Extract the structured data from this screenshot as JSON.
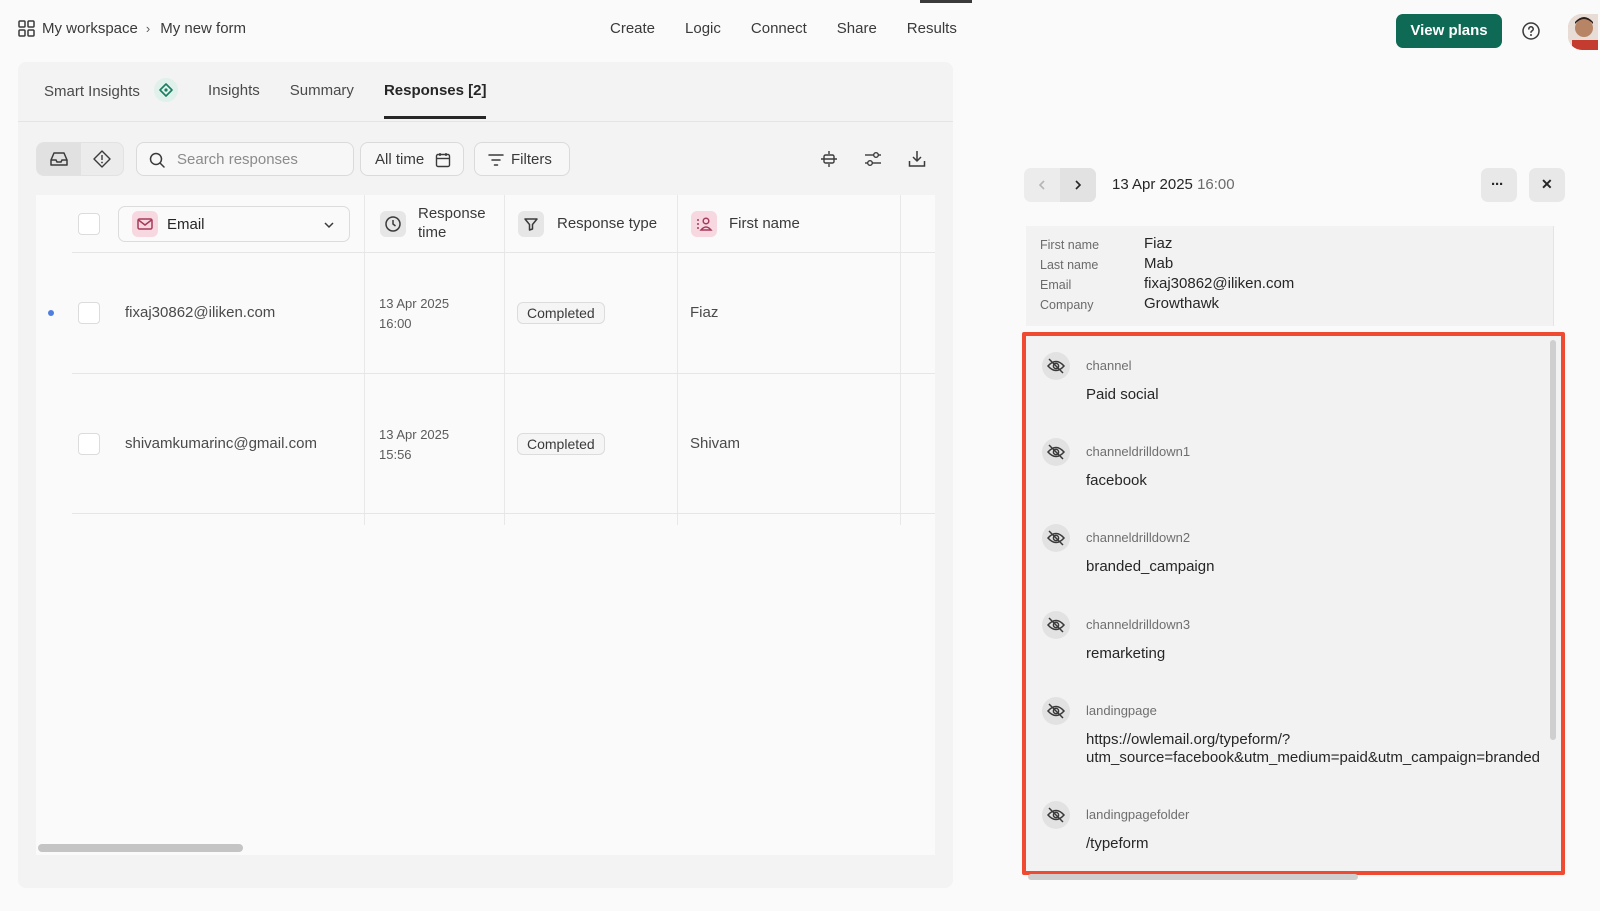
{
  "breadcrumb": {
    "workspace": "My workspace",
    "separator": "›",
    "form": "My new form"
  },
  "main_nav": [
    "Create",
    "Logic",
    "Connect",
    "Share",
    "Results"
  ],
  "active_main_nav": "Results",
  "header_buttons": {
    "view_plans": "View plans"
  },
  "sub_tabs": [
    "Smart Insights",
    "Insights",
    "Summary",
    "Responses [2]"
  ],
  "active_sub_tab": "Responses [2]",
  "toolbar": {
    "search_placeholder": "Search responses",
    "time_filter": "All time",
    "filters": "Filters"
  },
  "table": {
    "columns": {
      "email": "Email",
      "response_time_line1": "Response",
      "response_time_line2": "time",
      "response_type": "Response type",
      "first_name": "First name"
    },
    "rows": [
      {
        "email": "fixaj30862@iliken.com",
        "date": "13 Apr 2025",
        "time": "16:00",
        "type": "Completed",
        "first_name": "Fiaz",
        "unread": true
      },
      {
        "email": "shivamkumarinc@gmail.com",
        "date": "13 Apr 2025",
        "time": "15:56",
        "type": "Completed",
        "first_name": "Shivam",
        "unread": false
      }
    ]
  },
  "detail": {
    "date": "13 Apr 2025",
    "time": "16:00",
    "more_label": "···",
    "close_label": "✕",
    "meta": [
      {
        "key": "First name",
        "value": "Fiaz"
      },
      {
        "key": "Last name",
        "value": "Mab"
      },
      {
        "key": "Email",
        "value": "fixaj30862@iliken.com"
      },
      {
        "key": "Company",
        "value": "Growthawk"
      }
    ],
    "hidden_fields": [
      {
        "name": "channel",
        "value": "Paid social"
      },
      {
        "name": "channeldrilldown1",
        "value": "facebook"
      },
      {
        "name": "channeldrilldown2",
        "value": "branded_campaign"
      },
      {
        "name": "channeldrilldown3",
        "value": "remarketing"
      },
      {
        "name": "landingpage",
        "value": "https://owlemail.org/typeform/?\nutm_source=facebook&utm_medium=paid&utm_campaign=branded"
      },
      {
        "name": "landingpagefolder",
        "value": "/typeform"
      }
    ]
  },
  "colors": {
    "accent": "#0e6a54",
    "highlight": "#ee4b32",
    "unread_dot": "#4d7fe0"
  },
  "icons": [
    "grid-icon",
    "help-icon",
    "smart-insights-icon",
    "inbox-icon",
    "tag-icon",
    "search-icon",
    "calendar-icon",
    "filter-icon",
    "column-icon",
    "settings-icon",
    "download-icon",
    "mail-icon",
    "chevron-down-icon",
    "clock-icon",
    "funnel-icon",
    "person-icon",
    "chevron-left-icon",
    "chevron-right-icon",
    "eye-off-icon"
  ]
}
